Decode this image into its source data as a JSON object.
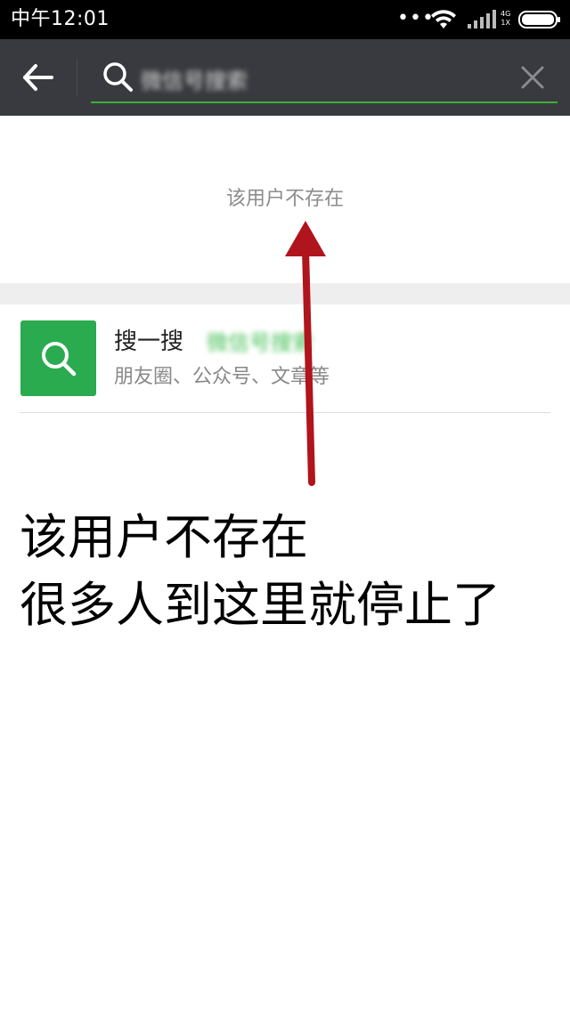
{
  "status_bar": {
    "time": "中午12:01",
    "dots": "•••",
    "network_top": "4G",
    "network_bottom": "1X"
  },
  "search": {
    "query": "微信号搜索"
  },
  "result": {
    "not_found": "该用户不存在"
  },
  "search_item": {
    "title": "搜一搜",
    "keyword": "微信号搜索",
    "subtitle": "朋友圈、公众号、文章等"
  },
  "annotation": {
    "line1": "该用户不存在",
    "line2": "很多人到这里就停止了"
  },
  "colors": {
    "accent": "#2bab4f",
    "toolbar": "#393a3f",
    "annotation_arrow": "#b0141c"
  },
  "icons": {
    "back": "arrow-left-icon",
    "search": "search-icon",
    "clear": "close-icon",
    "wifi": "wifi-icon",
    "signal": "signal-icon",
    "battery": "battery-icon"
  }
}
